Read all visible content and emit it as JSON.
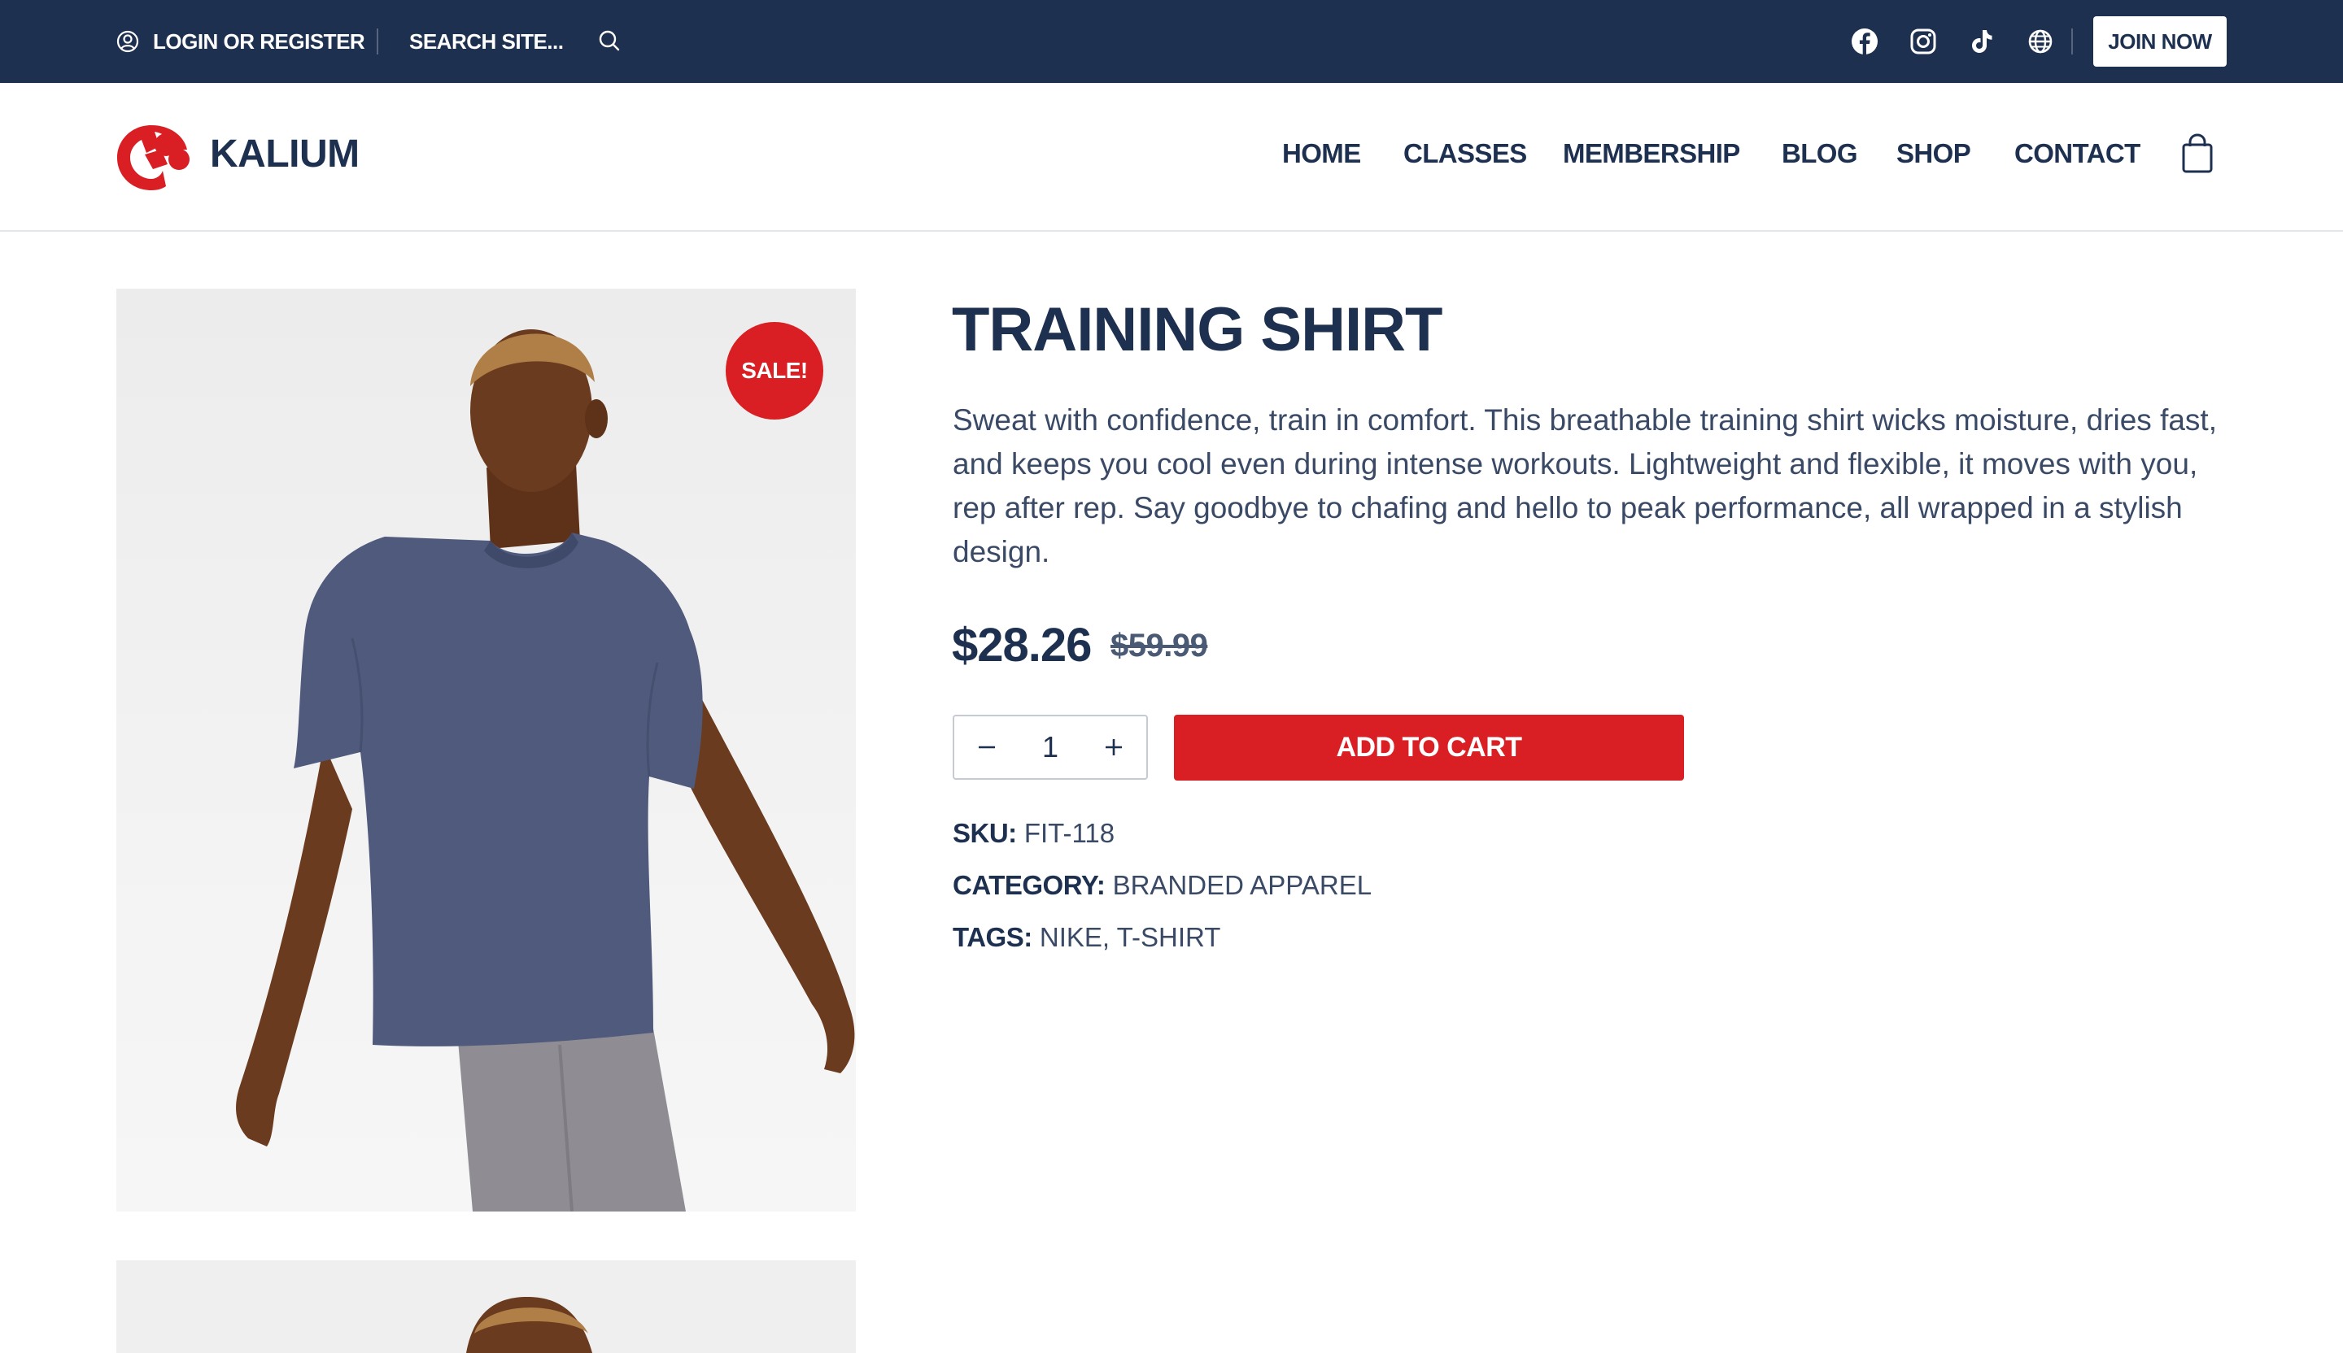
{
  "topbar": {
    "login_label": "LOGIN OR REGISTER",
    "search_label": "SEARCH SITE...",
    "social": [
      "facebook-icon",
      "instagram-icon",
      "tiktok-icon",
      "globe-icon"
    ],
    "join_label": "JOIN NOW"
  },
  "header": {
    "logo_text": "KALIUM",
    "nav": [
      "HOME",
      "CLASSES",
      "MEMBERSHIP",
      "BLOG",
      "SHOP",
      "CONTACT"
    ]
  },
  "product": {
    "sale_badge": "SALE!",
    "title": "TRAINING SHIRT",
    "description": "Sweat with confidence, train in comfort. This breathable training shirt wicks moisture, dries fast, and keeps you cool even during intense workouts. Lightweight and flexible, it moves with you, rep after rep. Say goodbye to chafing and hello to peak performance, all wrapped in a stylish design.",
    "price": "$28.26",
    "price_old": "$59.99",
    "quantity": "1",
    "add_to_cart": "ADD TO CART",
    "sku_label": "SKU:",
    "sku": "FIT-118",
    "category_label": "CATEGORY:",
    "category": "BRANDED APPAREL",
    "tags_label": "TAGS:",
    "tags": "NIKE, T-SHIRT"
  },
  "colors": {
    "navy": "#1e3050",
    "accent_red": "#d91e24",
    "text_muted": "#3a4a66"
  }
}
